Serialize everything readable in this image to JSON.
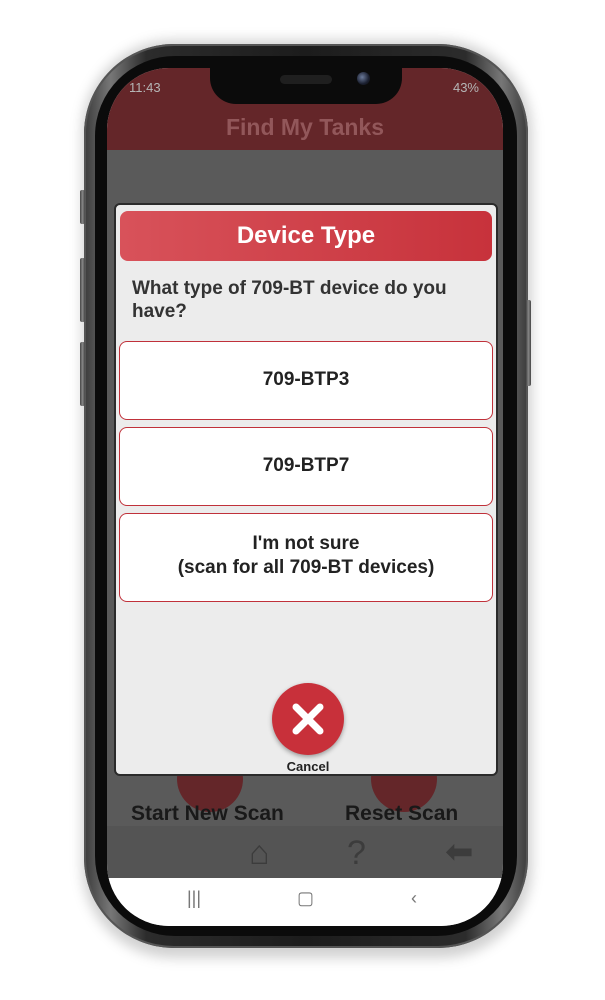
{
  "status_bar": {
    "time": "11:43",
    "battery": "43%"
  },
  "app": {
    "title": "Find My Tanks",
    "actions": [
      {
        "label": "Start New Scan"
      },
      {
        "label": "Reset Scan"
      }
    ],
    "bottom_nav": [
      {
        "icon": "home-icon"
      },
      {
        "icon": "help-icon"
      },
      {
        "icon": "back-arrow-icon"
      }
    ]
  },
  "dialog": {
    "title": "Device Type",
    "question": "What type of 709-BT device do you have?",
    "options": [
      {
        "lines": [
          "709-BTP3"
        ]
      },
      {
        "lines": [
          "709-BTP7"
        ]
      },
      {
        "lines": [
          "I'm not sure",
          "(scan for all 709-BT devices)"
        ]
      }
    ],
    "cancel_label": "Cancel",
    "colors": {
      "accent": "#c8303a",
      "header_start": "#d8525a",
      "header_end": "#c7323b"
    }
  }
}
